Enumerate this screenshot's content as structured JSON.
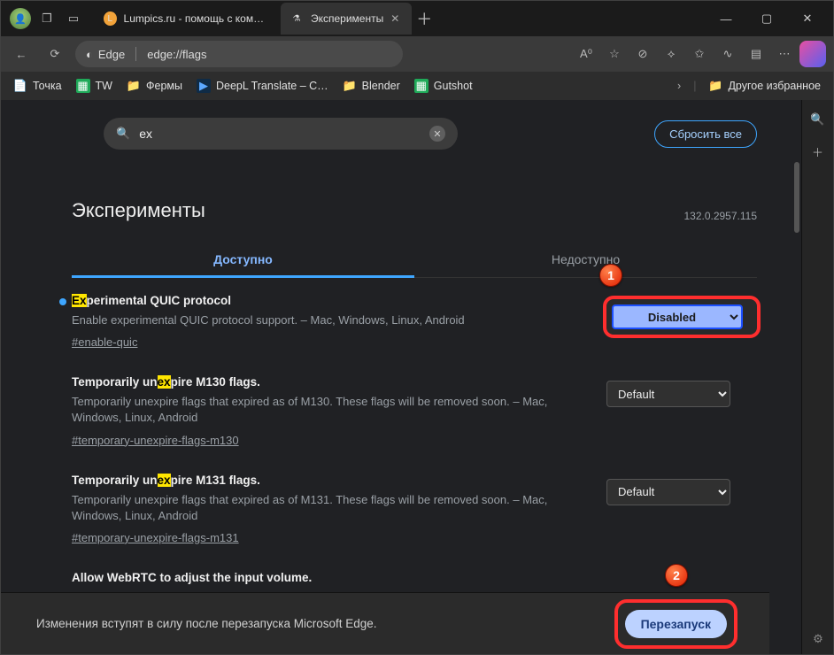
{
  "titlebar": {
    "tabs": [
      {
        "label": "Lumpics.ru - помощь с компьюте"
      },
      {
        "label": "Эксперименты"
      }
    ]
  },
  "toolbar": {
    "brand_label": "Edge",
    "url": "edge://flags"
  },
  "bookmarks": {
    "items": [
      {
        "label": "Точка",
        "icon": "📄",
        "color": "#f2c94c"
      },
      {
        "label": "TW",
        "icon": "▦",
        "color": "#1faa59"
      },
      {
        "label": "Фермы",
        "icon": "📁",
        "color": "#f2c94c"
      },
      {
        "label": "DeepL Translate – C…",
        "icon": "▶",
        "color": "#0f2b46"
      },
      {
        "label": "Blender",
        "icon": "📁",
        "color": "#f2c94c"
      },
      {
        "label": "Gutshot",
        "icon": "▦",
        "color": "#1faa59"
      }
    ],
    "other": "Другое избранное"
  },
  "page": {
    "search_value": "ex",
    "reset_label": "Сбросить все",
    "title": "Эксперименты",
    "version": "132.0.2957.115",
    "tab_available": "Доступно",
    "tab_unavailable": "Недоступно"
  },
  "flags": [
    {
      "title_pre": "",
      "title_hl": "Ex",
      "title_post": "perimental QUIC protocol",
      "desc": "Enable experimental QUIC protocol support. – Mac, Windows, Linux, Android",
      "anchor": "#enable-quic",
      "value": "Disabled",
      "changed": true
    },
    {
      "title_pre": "Temporarily un",
      "title_hl": "ex",
      "title_post": "pire M130 flags.",
      "desc": "Temporarily unexpire flags that expired as of M130. These flags will be removed soon. – Mac, Windows, Linux, Android",
      "anchor": "#temporary-unexpire-flags-m130",
      "value": "Default",
      "changed": false
    },
    {
      "title_pre": "Temporarily un",
      "title_hl": "ex",
      "title_post": "pire M131 flags.",
      "desc": "Temporarily unexpire flags that expired as of M131. These flags will be removed soon. – Mac, Windows, Linux, Android",
      "anchor": "#temporary-unexpire-flags-m131",
      "value": "Default",
      "changed": false
    },
    {
      "title_pre": "Allow WebRTC to adjust the input volume.",
      "title_hl": "",
      "title_post": "",
      "desc": "",
      "anchor": "",
      "value": "",
      "changed": false
    }
  ],
  "footer": {
    "message": "Изменения вступят в силу после перезапуска Microsoft Edge.",
    "restart_label": "Перезапуск"
  },
  "callouts": {
    "one": "1",
    "two": "2"
  }
}
